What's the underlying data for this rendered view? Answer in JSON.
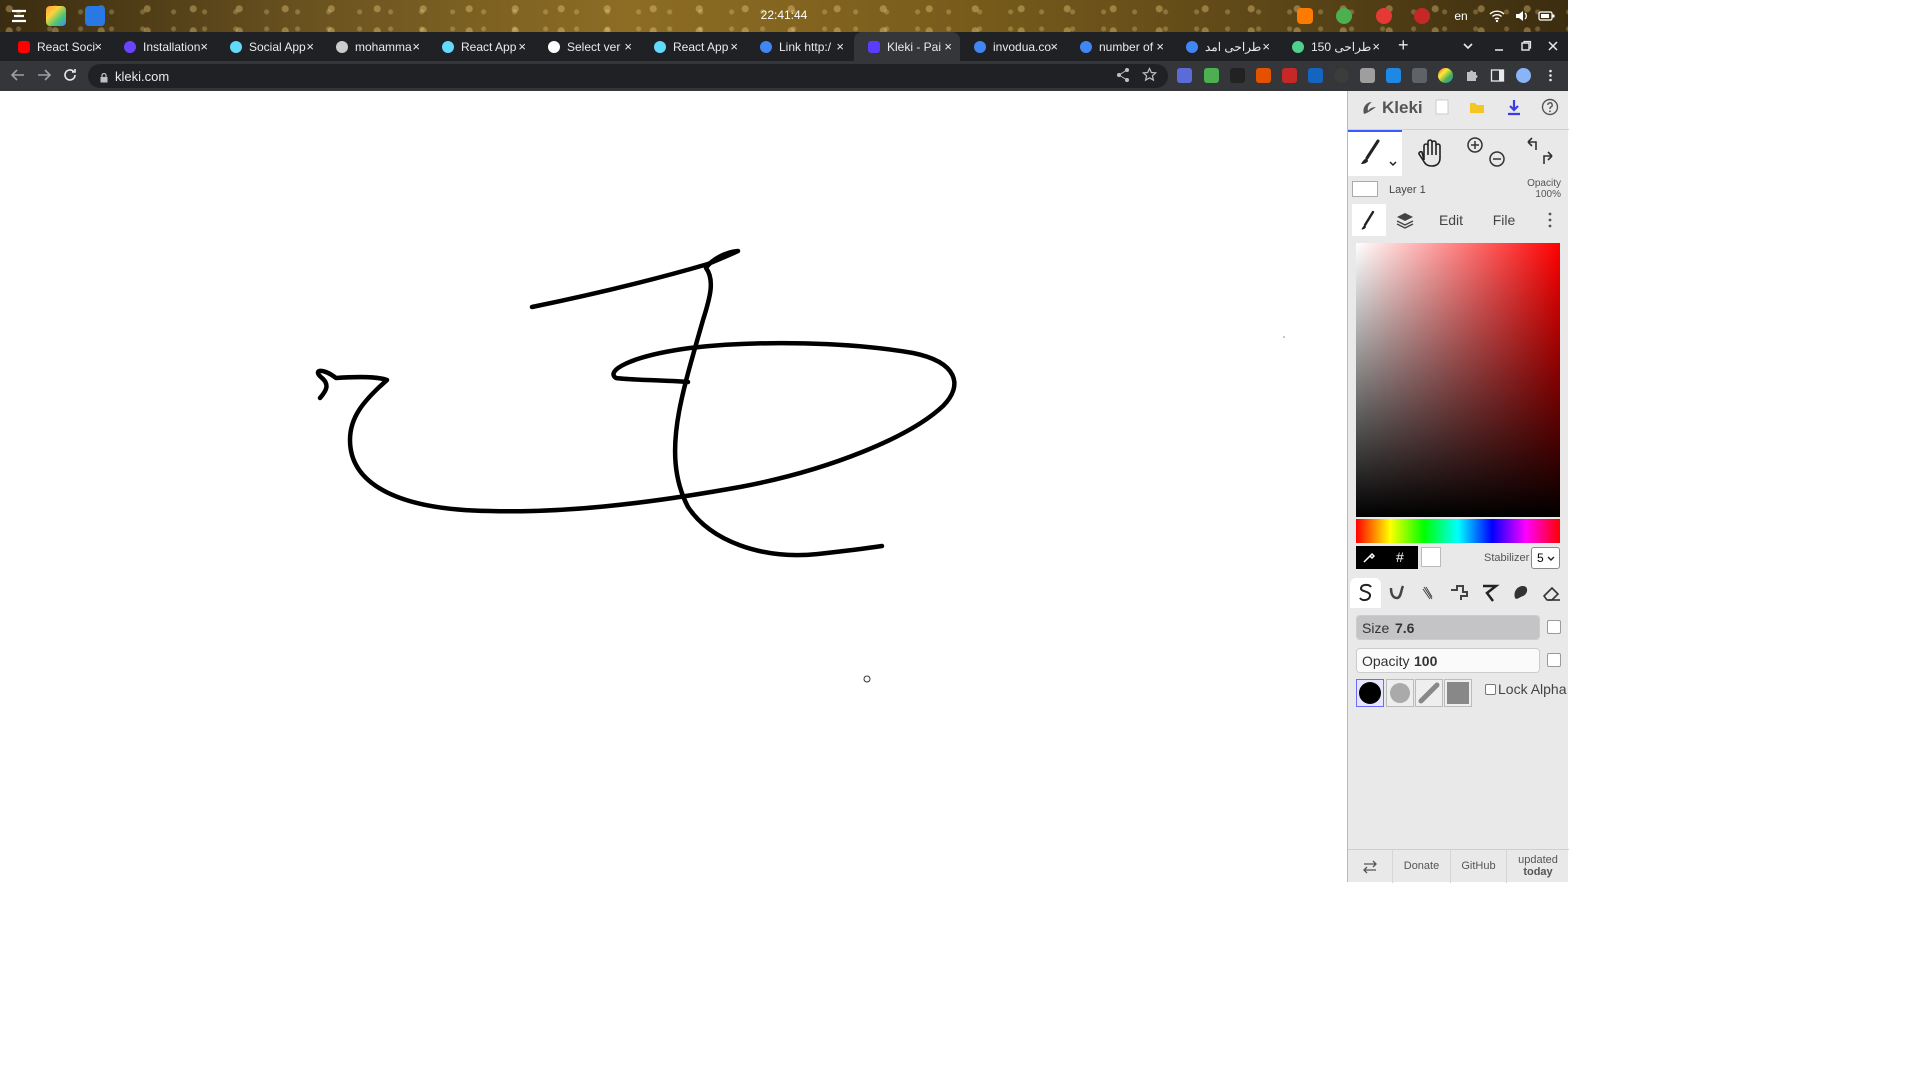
{
  "os": {
    "clock": "22:41:44",
    "lang": "en"
  },
  "browser": {
    "tabs": [
      {
        "label": "React Soci",
        "favicon_color": "#ff0000"
      },
      {
        "label": "Installation",
        "favicon_color": "#6b43ff"
      },
      {
        "label": "Social App",
        "favicon_color": "#61dafb"
      },
      {
        "label": "mohamma",
        "favicon_color": "#cccccc"
      },
      {
        "label": "React App",
        "favicon_color": "#61dafb"
      },
      {
        "label": "Select ver",
        "favicon_color": "#ffffff"
      },
      {
        "label": "React App",
        "favicon_color": "#61dafb"
      },
      {
        "label": "Link http:/",
        "favicon_color": "#4285f4"
      },
      {
        "label": "Kleki - Pai",
        "favicon_color": "#5b3cff"
      },
      {
        "label": "invodua.co",
        "favicon_color": "#4285f4"
      },
      {
        "label": "number of",
        "favicon_color": "#4285f4"
      },
      {
        "label": "طراحی امد",
        "favicon_color": "#4285f4"
      },
      {
        "label": "150 طراحی",
        "favicon_color": "#4fd18b"
      }
    ],
    "active_tab_index": 8,
    "close_glyph": "×",
    "new_tab_glyph": "+",
    "url": "kleki.com"
  },
  "kleki": {
    "logo": "Kleki",
    "layer": {
      "name": "Layer 1",
      "opacity_label": "Opacity",
      "opacity_value": "100%"
    },
    "tabs": {
      "edit": "Edit",
      "file": "File"
    },
    "hash": "#",
    "stabilizer": {
      "label": "Stabilizer",
      "value": "5"
    },
    "size": {
      "label": "Size",
      "value": "7.6"
    },
    "opacity": {
      "label": "Opacity",
      "value": "100"
    },
    "lock_alpha": "Lock Alpha",
    "footer": {
      "donate": "Donate",
      "github": "GitHub",
      "updated_line1": "updated",
      "updated_line2": "today"
    }
  },
  "colors": {
    "accent": "#3b5bff",
    "primary_color": "#000000",
    "secondary_color": "#ffffff"
  }
}
